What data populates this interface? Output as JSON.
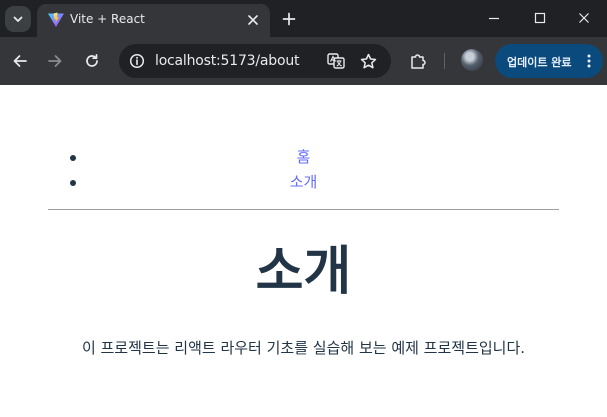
{
  "browser": {
    "tab": {
      "title": "Vite + React"
    },
    "address_bar": {
      "url": "localhost:5173/about"
    },
    "update_button": {
      "label": "업데이트 완료"
    }
  },
  "page": {
    "nav": [
      {
        "label": "홈"
      },
      {
        "label": "소개"
      }
    ],
    "title": "소개",
    "description": "이 프로젝트는 리액트 라우터 기초를 실습해 보는 예제 프로젝트입니다."
  },
  "colors": {
    "tabstrip_bg": "#202124",
    "toolbar_bg": "#35363a",
    "link": "#646cff",
    "text": "#213547",
    "update_button_bg": "#0b4a7c"
  },
  "icons": {
    "tab_search": "chevron-down-icon",
    "favicon": "vite-logo-icon",
    "tab_close": "close-icon",
    "new_tab": "plus-icon",
    "minimize": "minimize-icon",
    "maximize": "maximize-icon",
    "close_window": "close-icon",
    "back": "arrow-left-icon",
    "forward": "arrow-right-icon",
    "reload": "reload-icon",
    "site_info": "info-icon",
    "translate": "translate-icon",
    "bookmark": "star-icon",
    "extensions": "puzzle-icon",
    "profile": "avatar",
    "menu": "kebab-menu-icon"
  }
}
